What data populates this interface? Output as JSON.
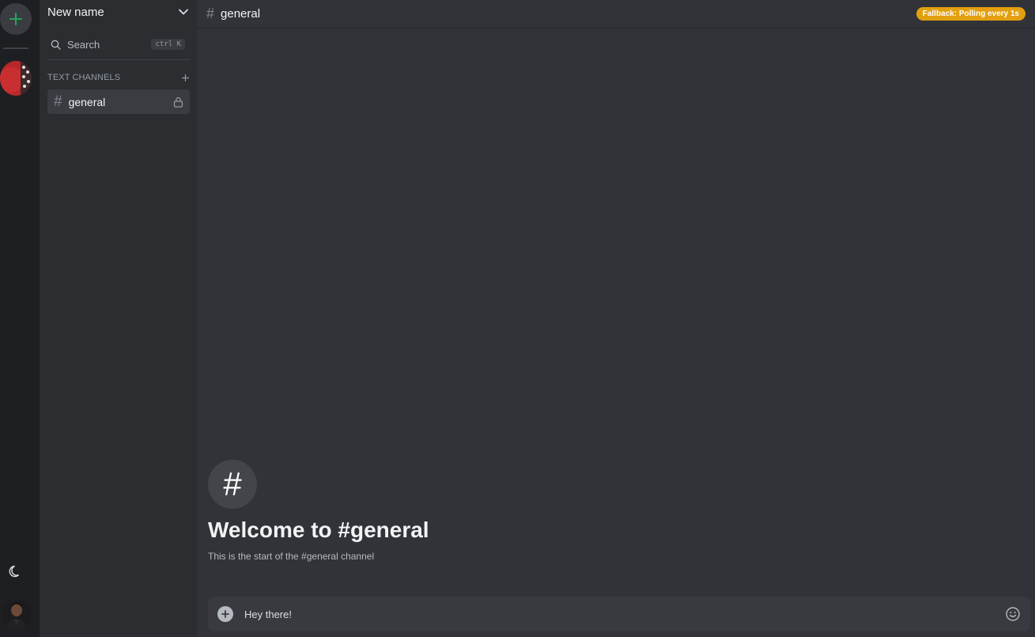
{
  "rail": {
    "add_server_icon": "plus-icon",
    "theme_icon": "moon-icon",
    "accent": "#23a55a"
  },
  "sidebar": {
    "guild_name": "New name",
    "search_label": "Search",
    "search_shortcut": "ctrl K",
    "category_label": "TEXT CHANNELS",
    "channels": [
      {
        "name": "general",
        "locked": true,
        "selected": true
      }
    ]
  },
  "topbar": {
    "channel_name": "general",
    "status_badge": "Fallback: Polling every 1s",
    "badge_color": "#e29f0f"
  },
  "welcome": {
    "icon_glyph": "#",
    "title": "Welcome to #general",
    "subtitle": "This is the start of the #general channel"
  },
  "composer": {
    "value": "Hey there!"
  }
}
